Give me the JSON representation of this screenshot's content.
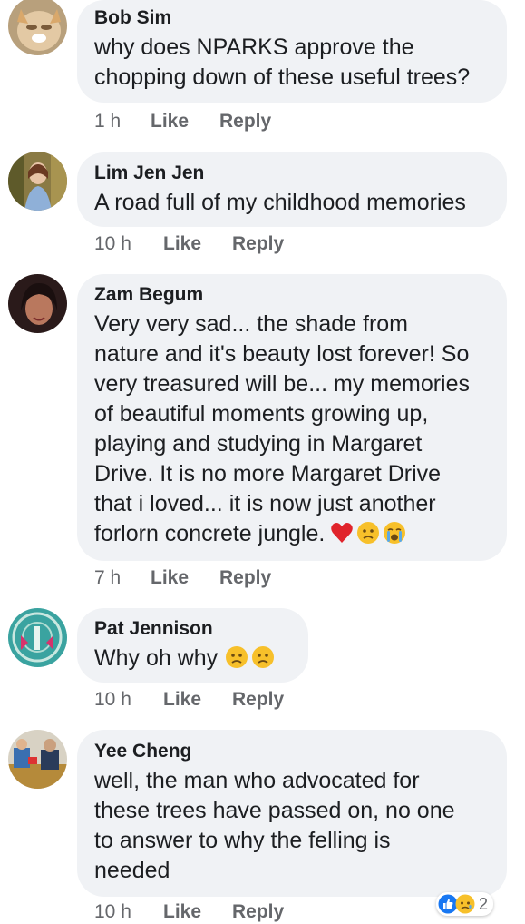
{
  "comments": [
    {
      "author": "Bob Sim",
      "lines": [
        "why does NPARKS approve the",
        "chopping down of these useful trees?"
      ],
      "time": "1 h",
      "like": "Like",
      "reply": "Reply"
    },
    {
      "author": "Lim Jen Jen",
      "lines": [
        "A road full of my childhood memories"
      ],
      "time": "10 h",
      "like": "Like",
      "reply": "Reply"
    },
    {
      "author": "Zam Begum",
      "lines": [
        "Very very sad... the shade from",
        "nature and it's beauty lost forever! So",
        "very treasured will be... my memories",
        "of beautiful moments growing up,",
        "playing and studying in Margaret",
        "Drive. It is no more Margaret Drive",
        "that i loved... it is now just another",
        "forlorn concrete jungle."
      ],
      "emojis": [
        "red-heart",
        "sad-face",
        "crying-face"
      ],
      "time": "7 h",
      "like": "Like",
      "reply": "Reply"
    },
    {
      "author": "Pat Jennison",
      "lines": [
        "Why oh why"
      ],
      "emojis": [
        "sad-face",
        "sad-face"
      ],
      "time": "10 h",
      "like": "Like",
      "reply": "Reply"
    },
    {
      "author": "Yee Cheng",
      "lines": [
        "well, the man who advocated for",
        "these trees have passed on, no one",
        "to answer to why the felling is",
        "needed"
      ],
      "time": "10 h",
      "like": "Like",
      "reply": "Reply",
      "reactions": {
        "icons": [
          "like-icon",
          "sad-icon"
        ],
        "count": "2"
      }
    }
  ],
  "colors": {
    "bubble": "#f0f2f5",
    "text": "#1c1e21",
    "meta": "#65676b",
    "like_blue": "#1877f2"
  }
}
